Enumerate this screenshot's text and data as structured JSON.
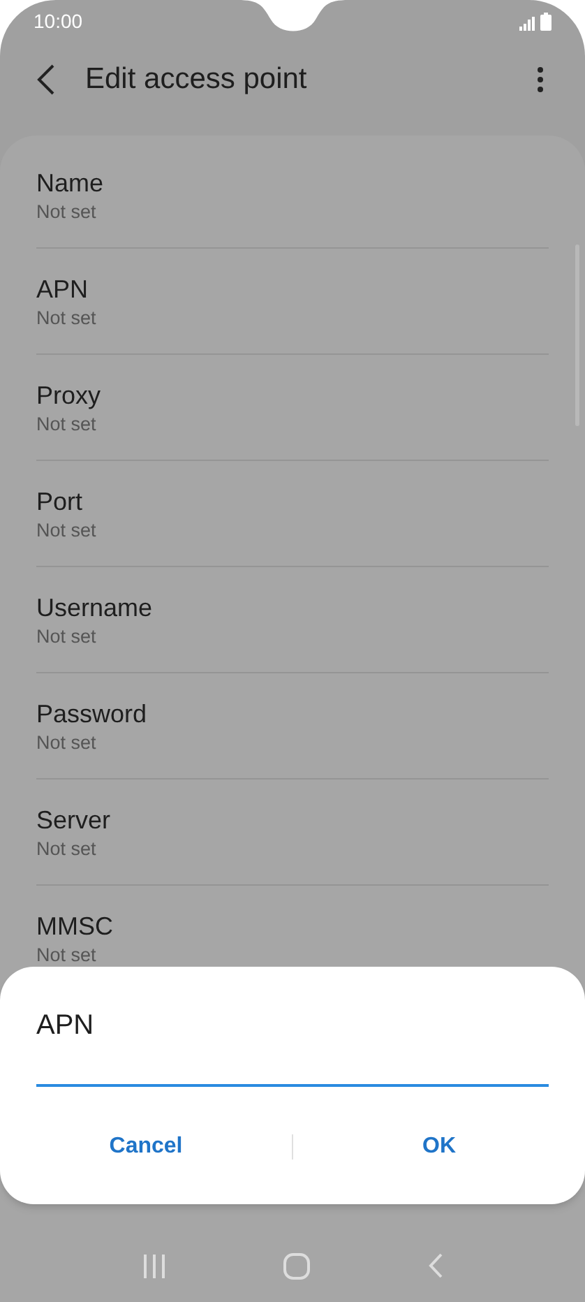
{
  "status_bar": {
    "time": "10:00"
  },
  "header": {
    "title": "Edit access point"
  },
  "settings": [
    {
      "label": "Name",
      "value": "Not set"
    },
    {
      "label": "APN",
      "value": "Not set"
    },
    {
      "label": "Proxy",
      "value": "Not set"
    },
    {
      "label": "Port",
      "value": "Not set"
    },
    {
      "label": "Username",
      "value": "Not set"
    },
    {
      "label": "Password",
      "value": "Not set"
    },
    {
      "label": "Server",
      "value": "Not set"
    },
    {
      "label": "MMSC",
      "value": "Not set"
    }
  ],
  "dialog": {
    "title": "APN",
    "buttons": [
      "Cancel",
      "OK"
    ]
  }
}
